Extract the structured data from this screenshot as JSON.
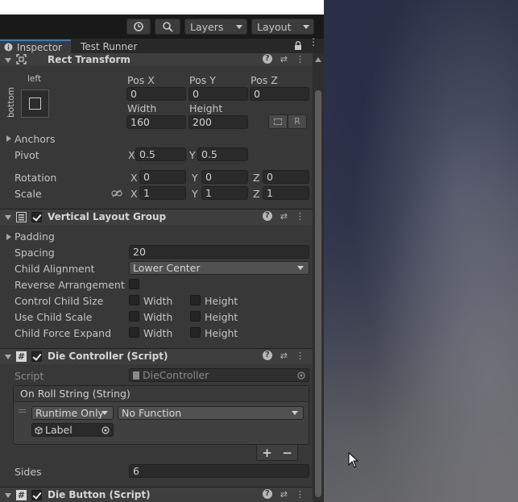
{
  "toolbar": {
    "layers_label": "Layers",
    "layout_label": "Layout"
  },
  "tabs": [
    {
      "label": "Inspector",
      "active": true
    },
    {
      "label": "Test Runner",
      "active": false
    }
  ],
  "rect_transform": {
    "title": "Rect Transform",
    "anchor_h": "left",
    "anchor_v": "bottom",
    "pos_x_label": "Pos X",
    "pos_x": "0",
    "pos_y_label": "Pos Y",
    "pos_y": "0",
    "pos_z_label": "Pos Z",
    "pos_z": "0",
    "width_label": "Width",
    "width": "160",
    "height_label": "Height",
    "height": "200",
    "r_button": "R",
    "anchors_label": "Anchors",
    "pivot_label": "Pivot",
    "pivot_x": "0.5",
    "pivot_y": "0.5",
    "rotation_label": "Rotation",
    "rot_x": "0",
    "rot_y": "0",
    "rot_z": "0",
    "scale_label": "Scale",
    "scale_x": "1",
    "scale_y": "1",
    "scale_z": "1",
    "x": "X",
    "y": "Y",
    "z": "Z"
  },
  "vlg": {
    "title": "Vertical Layout Group",
    "padding_label": "Padding",
    "spacing_label": "Spacing",
    "spacing": "20",
    "child_alignment_label": "Child Alignment",
    "child_alignment": "Lower Center",
    "reverse_label": "Reverse Arrangement",
    "control_size_label": "Control Child Size",
    "use_scale_label": "Use Child Scale",
    "force_expand_label": "Child Force Expand",
    "width": "Width",
    "height": "Height"
  },
  "die_controller": {
    "title": "Die Controller (Script)",
    "script_label": "Script",
    "script_value": "DieController",
    "event_title": "On Roll String (String)",
    "runtime": "Runtime Only",
    "function": "No Function",
    "target": "Label",
    "plus": "+",
    "minus": "−",
    "sides_label": "Sides",
    "sides": "6"
  },
  "die_button": {
    "title": "Die Button (Script)"
  }
}
